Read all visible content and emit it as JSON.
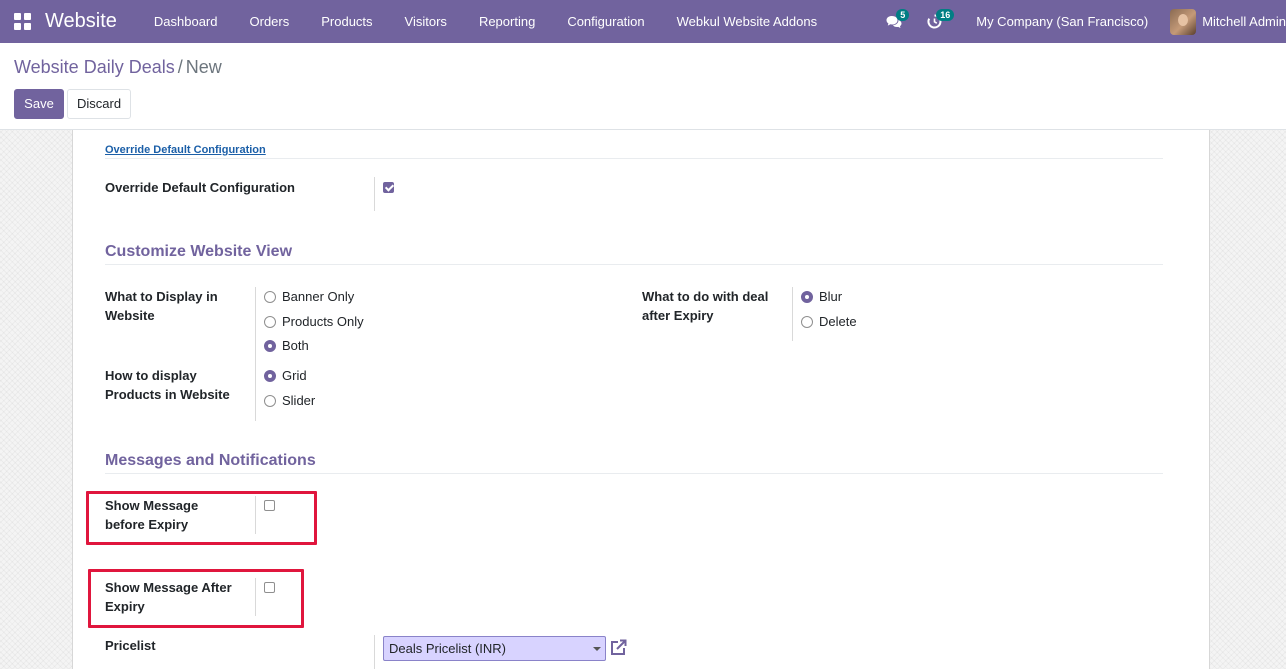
{
  "navbar": {
    "app_name": "Website",
    "menu": [
      "Dashboard",
      "Orders",
      "Products",
      "Visitors",
      "Reporting",
      "Configuration",
      "Webkul Website Addons"
    ],
    "messages_count": "5",
    "activities_count": "16",
    "company": "My Company (San Francisco)",
    "user": "Mitchell Admin"
  },
  "breadcrumb": {
    "parent": "Website Daily Deals",
    "separator": "/",
    "current": "New"
  },
  "buttons": {
    "save": "Save",
    "discard": "Discard"
  },
  "form": {
    "override_group_title": "Override Default Configuration",
    "override_label": "Override Default Configuration",
    "override_checked": true,
    "section_customize": "Customize Website View",
    "display_label_line1": "What to Display in",
    "display_label_line2": "Website",
    "display_options": [
      "Banner Only",
      "Products Only",
      "Both"
    ],
    "display_selected": "Both",
    "products_label_line1": "How to display",
    "products_label_line2": "Products in Website",
    "products_options": [
      "Grid",
      "Slider"
    ],
    "products_selected": "Grid",
    "expiry_label_line1": "What to do with deal",
    "expiry_label_line2": "after Expiry",
    "expiry_options": [
      "Blur",
      "Delete"
    ],
    "expiry_selected": "Blur",
    "section_messages": "Messages and Notifications",
    "before_label_line1": "Show Message",
    "before_label_line2": "before Expiry",
    "before_checked": false,
    "after_label_line1": "Show Message After",
    "after_label_line2": "Expiry",
    "after_checked": false,
    "pricelist_label": "Pricelist",
    "pricelist_value": "Deals Pricelist (INR)"
  },
  "colors": {
    "brand": "#71639e",
    "highlight": "#e0163d",
    "badge": "#017e84",
    "select_bg": "#d8d3ff"
  }
}
